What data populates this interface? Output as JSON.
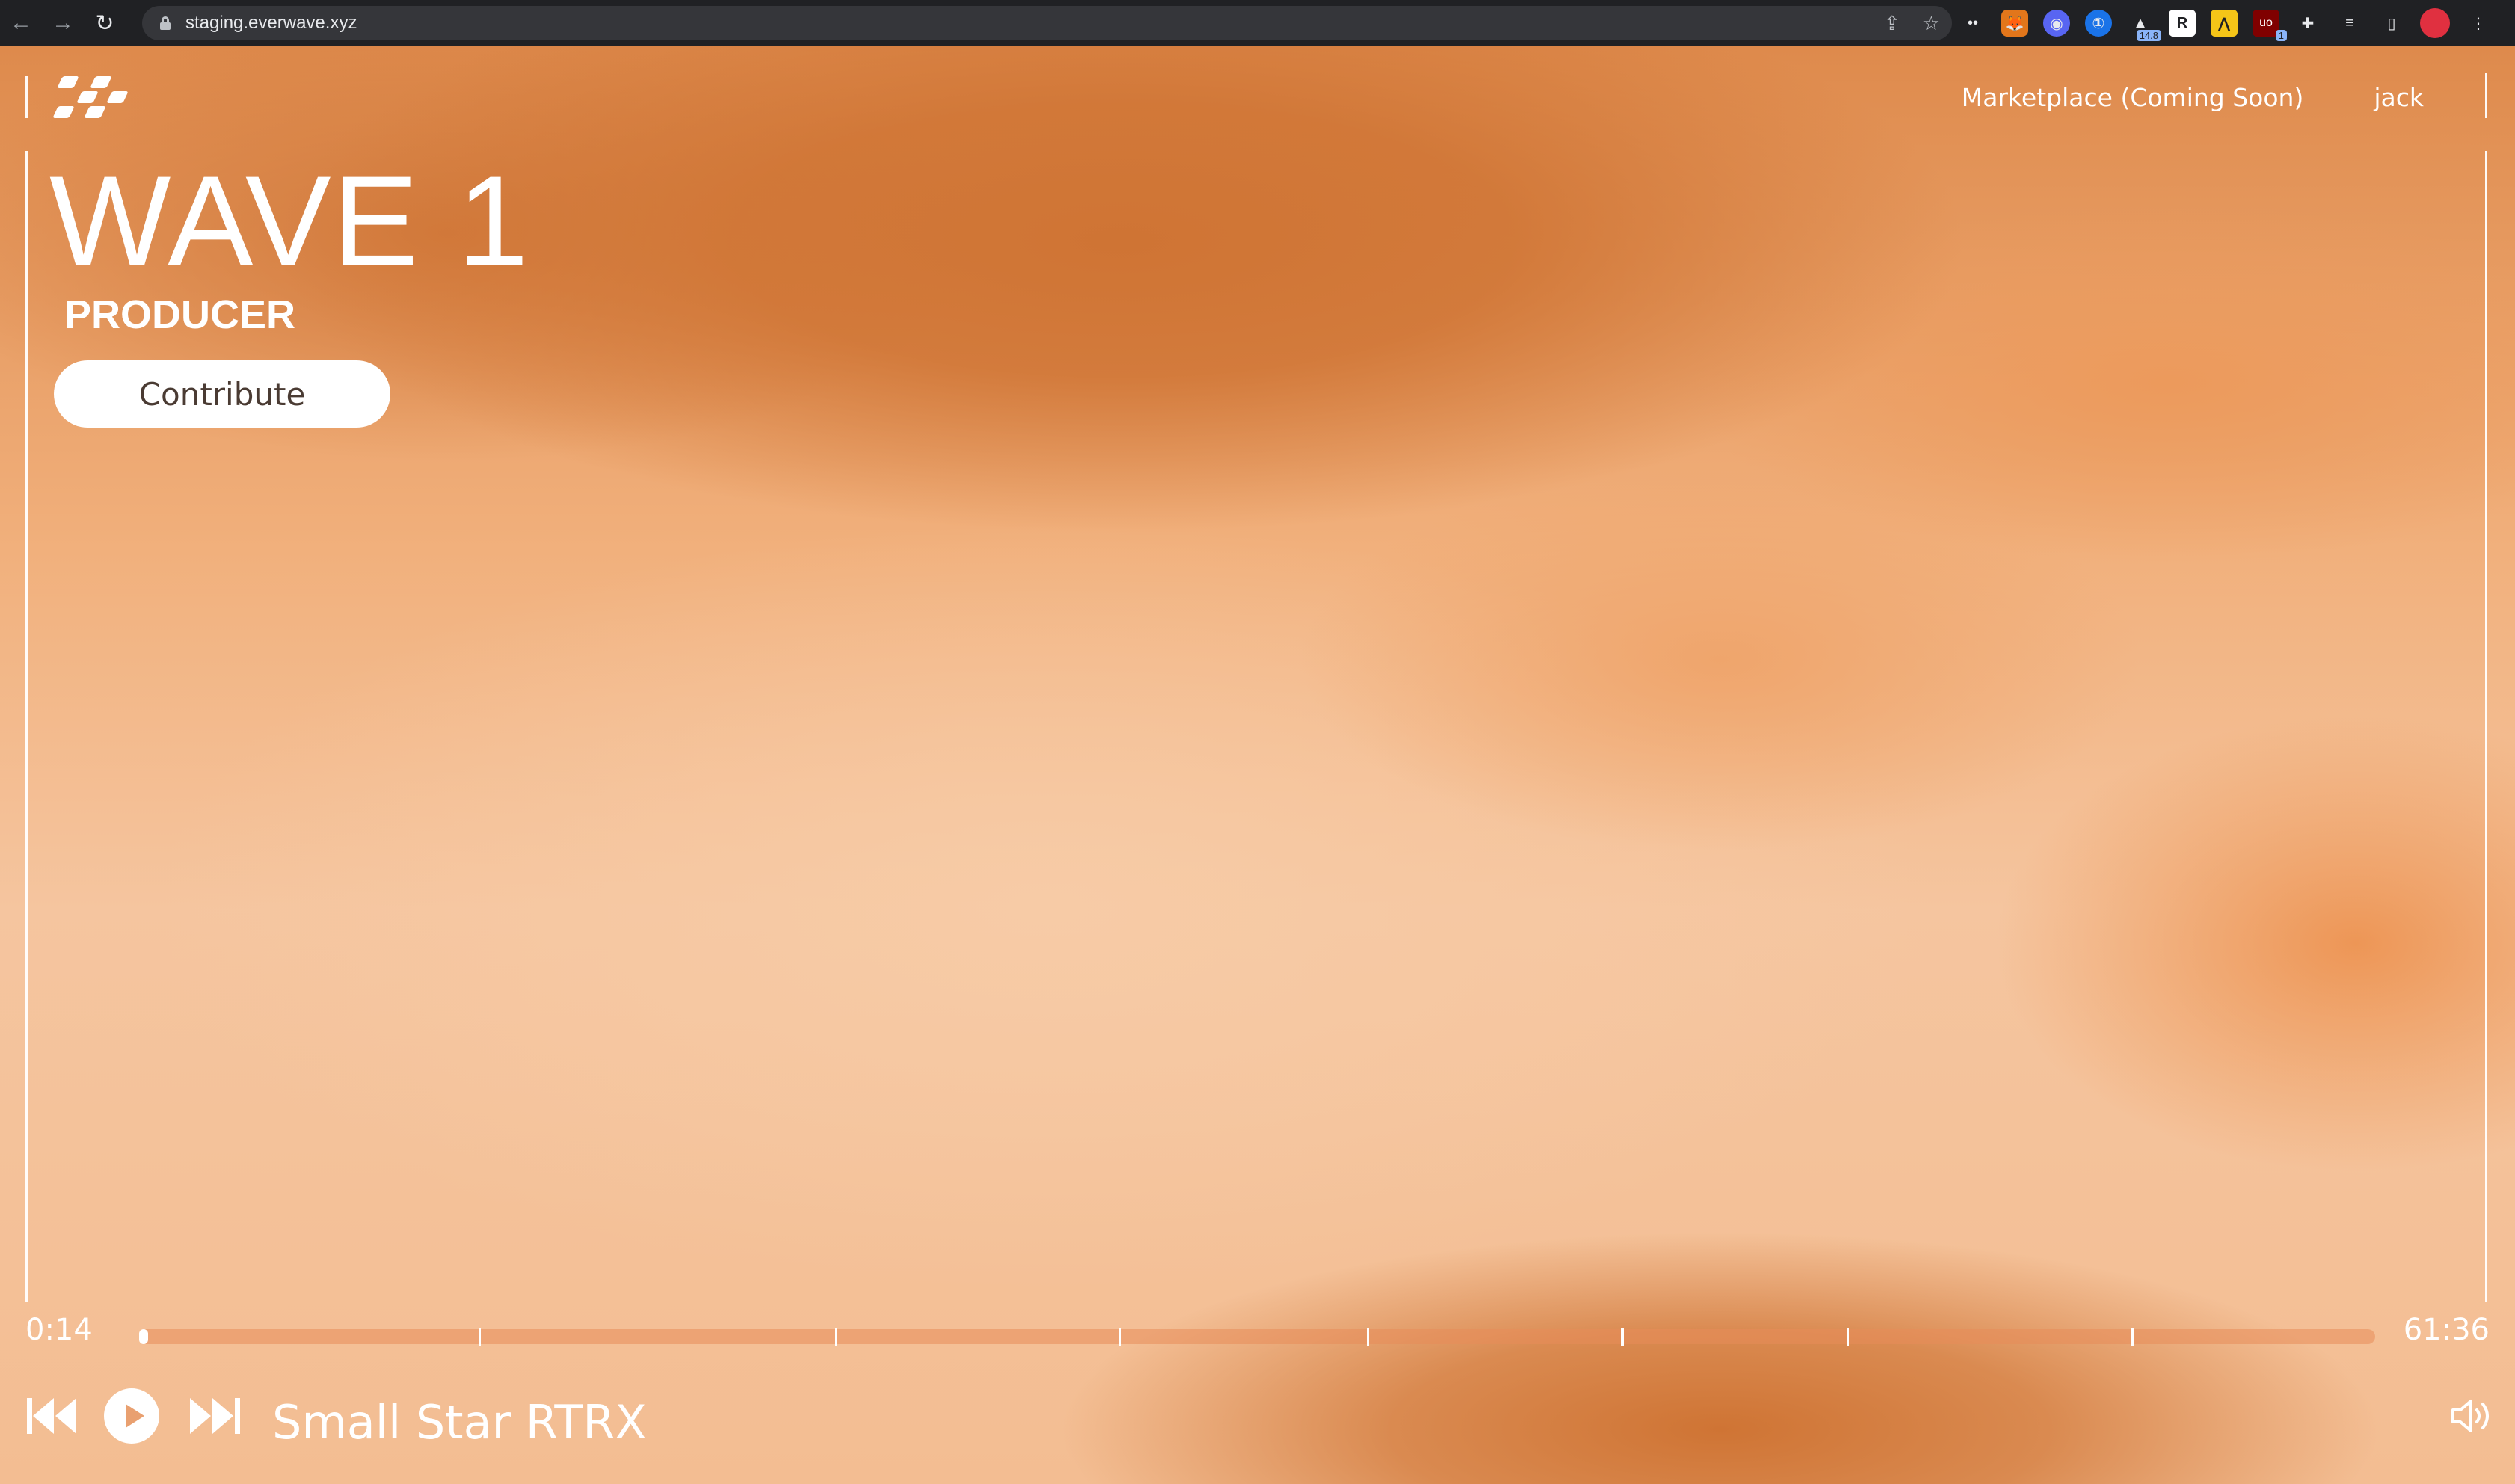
{
  "browser": {
    "url": "staging.everwave.xyz",
    "extension_badge": "14.8",
    "ublock_count": "1"
  },
  "nav": {
    "marketplace": "Marketplace (Coming Soon)",
    "user": "jack"
  },
  "hero": {
    "title": "WAVE 1",
    "role": "PRODUCER",
    "contribute_label": "Contribute"
  },
  "player": {
    "elapsed": "0:14",
    "duration": "61:36",
    "progress": 0.004,
    "track_title": "Small Star RTRX",
    "segment_markers": [
      0.152,
      0.311,
      0.438,
      0.549,
      0.663,
      0.764,
      0.891
    ]
  },
  "colors": {
    "accent_orange": "#cf7434",
    "peach": "#f5c59f",
    "text": "#ffffff"
  },
  "icons": [
    "back-icon",
    "forward-icon",
    "reload-icon",
    "lock-icon",
    "share-icon",
    "star-icon",
    "extensions-icon",
    "logo-icon",
    "skip-back-icon",
    "play-icon",
    "skip-forward-icon",
    "volume-icon"
  ]
}
